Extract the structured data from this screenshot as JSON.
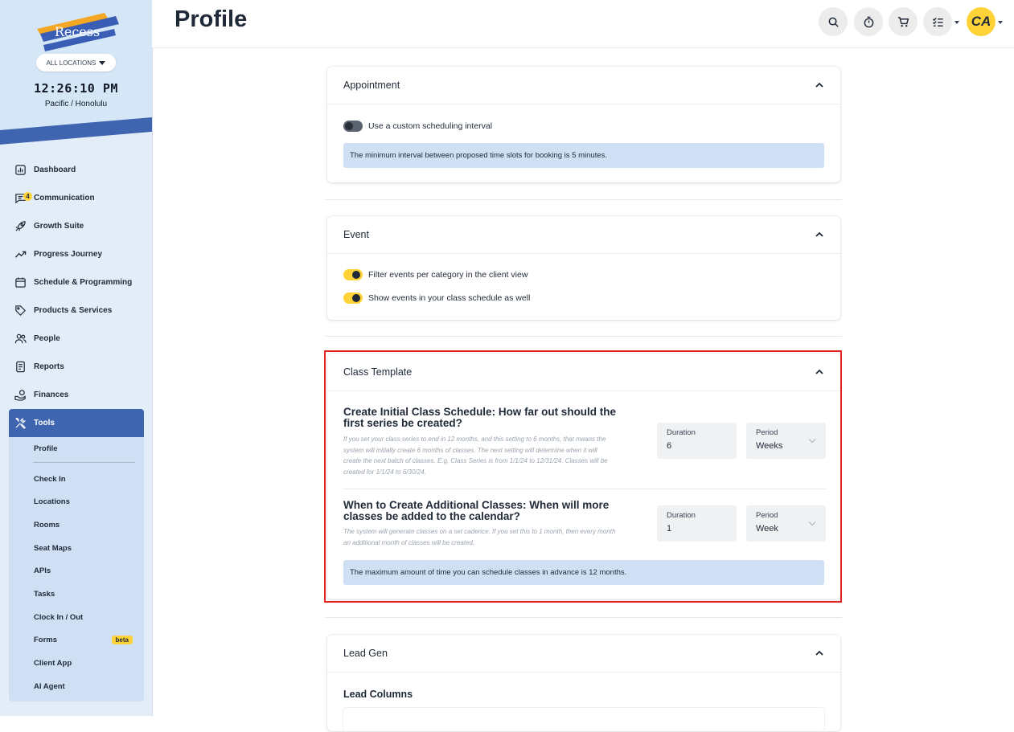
{
  "brand": {
    "logo_text": "Recess"
  },
  "location_selector": {
    "label": "ALL LOCATIONS"
  },
  "clock": {
    "time": "12:26:10 PM",
    "timezone": "Pacific / Honolulu"
  },
  "nav": {
    "items": [
      {
        "label": "Dashboard",
        "icon": "dashboard-icon"
      },
      {
        "label": "Communication",
        "icon": "chat-icon",
        "badge": "4"
      },
      {
        "label": "Growth Suite",
        "icon": "rocket-icon"
      },
      {
        "label": "Progress Journey",
        "icon": "trending-up-icon"
      },
      {
        "label": "Schedule & Programming",
        "icon": "calendar-icon"
      },
      {
        "label": "Products & Services",
        "icon": "tag-icon"
      },
      {
        "label": "People",
        "icon": "people-icon"
      },
      {
        "label": "Reports",
        "icon": "report-icon"
      },
      {
        "label": "Finances",
        "icon": "finance-icon"
      },
      {
        "label": "Tools",
        "icon": "tools-icon",
        "active": true
      }
    ],
    "tools_submenu": {
      "top": "Profile",
      "items": [
        "Check In",
        "Locations",
        "Rooms",
        "Seat Maps",
        "APIs",
        "Tasks",
        "Clock In / Out",
        "Forms",
        "Client App",
        "AI Agent"
      ],
      "forms_badge": "beta"
    }
  },
  "header": {
    "title": "Profile",
    "avatar_initials": "CA",
    "icons": [
      "search-icon",
      "timer-icon",
      "cart-icon",
      "checklist-icon"
    ]
  },
  "appointment": {
    "title": "Appointment",
    "toggle_label": "Use a custom scheduling interval",
    "toggle_on": false,
    "info": "The minimum interval between proposed time slots for booking is 5 minutes."
  },
  "event": {
    "title": "Event",
    "toggles": [
      {
        "label": "Filter events per category in the client view",
        "on": true
      },
      {
        "label": "Show events in your class schedule as well",
        "on": true
      }
    ]
  },
  "class_template": {
    "title": "Class Template",
    "initial": {
      "question": "Create Initial Class Schedule: How far out should the first series be created?",
      "help": "If you set your class series to end in 12 months, and this setting to 6 months, that means the system will initially create 6 months of classes. The next setting will determine when it will create the next batch of classes. E.g, Class Series is from 1/1/24 to 12/31/24. Classes will be created for 1/1/24 to 6/30/24.",
      "duration_label": "Duration",
      "duration_value": "6",
      "period_label": "Period",
      "period_value": "Weeks"
    },
    "additional": {
      "question": "When to Create Additional Classes: When will more classes be added to the calendar?",
      "help": "The system will generate classes on a set cadence. If you set this to 1 month, then every month an additional month of classes will be created.",
      "duration_label": "Duration",
      "duration_value": "1",
      "period_label": "Period",
      "period_value": "Week"
    },
    "info": "The maximum amount of time you can schedule classes in advance is 12 months."
  },
  "lead_gen": {
    "title": "Lead Gen",
    "subtitle": "Lead Columns"
  },
  "colors": {
    "accent_yellow": "#ffd338",
    "nav_active": "#3f64b0",
    "info_bg": "#cfe0f4",
    "highlight_border": "#e02424"
  }
}
